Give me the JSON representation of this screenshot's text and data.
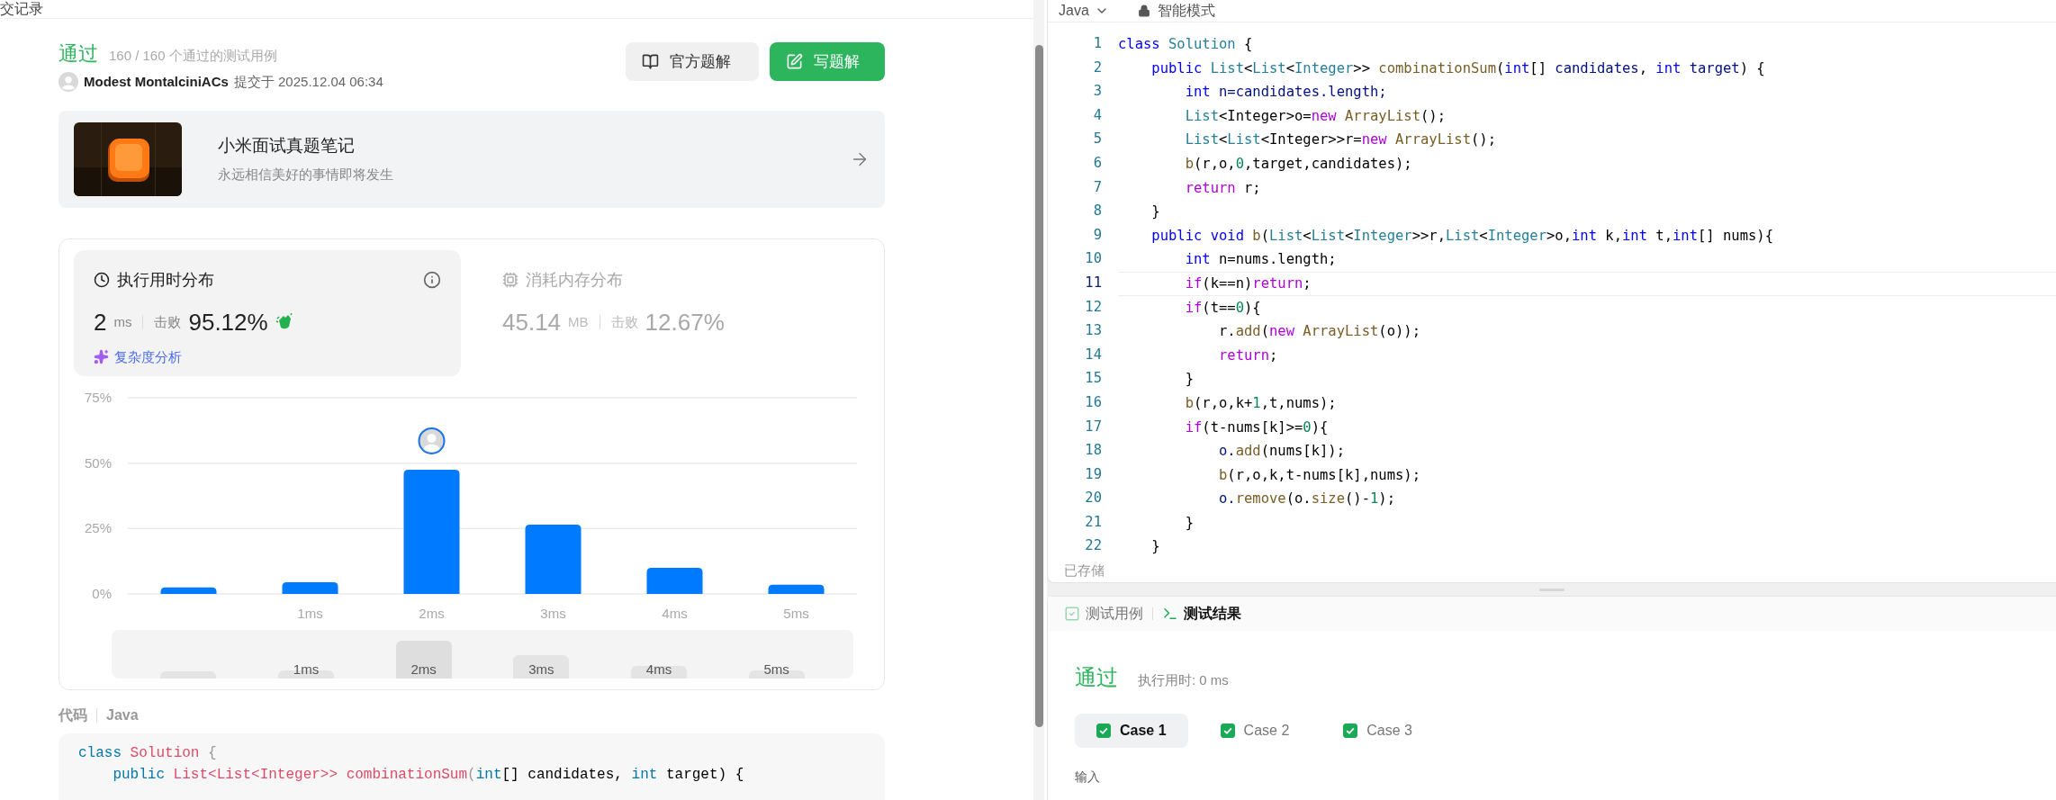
{
  "left_panel": {
    "header_title": "交记录"
  },
  "submission": {
    "status": "通过",
    "passed_cases": "160 / 160 个通过的测试用例",
    "author": "Modest MontalciniACs",
    "submitted_at": "提交于 2025.12.04 06:34",
    "buttons": [
      {
        "label": "官方题解",
        "kind": "secondary"
      },
      {
        "label": "写题解",
        "kind": "primary"
      }
    ]
  },
  "banner": {
    "title": "小米面试真题笔记",
    "subtitle": "永远相信美好的事情即将发生"
  },
  "metrics": [
    {
      "kind": "runtime",
      "title": "执行用时分布",
      "value": "2",
      "unit": "ms",
      "beat_label": "击败",
      "beat": "95.12%",
      "selected": true,
      "analysis_link": "复杂度分析"
    },
    {
      "kind": "memory",
      "title": "消耗内存分布",
      "value": "45.14",
      "unit": "MB",
      "beat_label": "击败",
      "beat": "12.67%",
      "selected": false
    }
  ],
  "runtime_chart": {
    "chart_data": {
      "type": "bar",
      "categories": [
        null,
        "1ms",
        "2ms",
        "3ms",
        "4ms",
        "5ms"
      ],
      "values": [
        2.5,
        4.5,
        47.5,
        26.5,
        10,
        3.5
      ],
      "ylim": [
        0,
        75
      ],
      "yticks": [
        {
          "value": 0,
          "label": "0%"
        },
        {
          "value": 25,
          "label": "25%"
        },
        {
          "value": 50,
          "label": "50%"
        },
        {
          "value": 75,
          "label": "75%"
        }
      ]
    },
    "bars": [
      {
        "selected": false
      },
      {
        "selected": false
      },
      {
        "selected": true
      },
      {
        "selected": false
      },
      {
        "selected": false
      },
      {
        "selected": false
      }
    ],
    "overview_labels": [
      "1ms",
      "2ms",
      "3ms",
      "4ms",
      "5ms"
    ]
  },
  "code_section": {
    "title": "代码",
    "language": "Java",
    "lines": [
      [
        {
          "text": "class",
          "kind": "k"
        },
        {
          "text": " Solution",
          "kind": "t"
        },
        {
          "text": " {",
          "kind": "g"
        }
      ],
      [
        {
          "text": "    public",
          "kind": "k"
        },
        {
          "text": " List<List<Integer>>",
          "kind": "t"
        },
        {
          "text": " combinationSum",
          "kind": "t"
        },
        {
          "text": "(",
          "kind": "g"
        },
        {
          "text": "int",
          "kind": "k"
        },
        {
          "text": "[] candidates,",
          "kind": "p"
        },
        {
          "text": " int",
          "kind": "k"
        },
        {
          "text": " target) {",
          "kind": "p"
        }
      ]
    ]
  },
  "editor": {
    "language": "Java",
    "mode": "智能模式",
    "save_status": "已存储",
    "lines": [
      {
        "number": "1",
        "current": false,
        "tokens": [
          {
            "text": "class",
            "kind": "k"
          },
          {
            "text": " Solution",
            "kind": "t"
          },
          {
            "text": " {",
            "kind": "p"
          }
        ]
      },
      {
        "number": "2",
        "current": false,
        "tokens": [
          {
            "text": "    public",
            "kind": "k"
          },
          {
            "text": " List",
            "kind": "t"
          },
          {
            "text": "<",
            "kind": "p"
          },
          {
            "text": "List",
            "kind": "t"
          },
          {
            "text": "<",
            "kind": "p"
          },
          {
            "text": "Integer",
            "kind": "t"
          },
          {
            "text": ">> ",
            "kind": "p"
          },
          {
            "text": "combinationSum",
            "kind": "f"
          },
          {
            "text": "(",
            "kind": "p"
          },
          {
            "text": "int",
            "kind": "k"
          },
          {
            "text": "[] ",
            "kind": "p"
          },
          {
            "text": "candidates",
            "kind": "v"
          },
          {
            "text": ", ",
            "kind": "p"
          },
          {
            "text": "int",
            "kind": "k"
          },
          {
            "text": " target",
            "kind": "v"
          },
          {
            "text": ") {",
            "kind": "p"
          }
        ]
      },
      {
        "number": "3",
        "current": false,
        "tokens": [
          {
            "text": "        int",
            "kind": "k"
          },
          {
            "text": " n=candidates.length;",
            "kind": "v"
          }
        ]
      },
      {
        "number": "4",
        "current": false,
        "tokens": [
          {
            "text": "        List",
            "kind": "t"
          },
          {
            "text": "<Integer>o=",
            "kind": "p"
          },
          {
            "text": "new",
            "kind": "c"
          },
          {
            "text": " ArrayList",
            "kind": "f"
          },
          {
            "text": "();",
            "kind": "p"
          }
        ]
      },
      {
        "number": "5",
        "current": false,
        "tokens": [
          {
            "text": "        List",
            "kind": "t"
          },
          {
            "text": "<",
            "kind": "p"
          },
          {
            "text": "List",
            "kind": "t"
          },
          {
            "text": "<Integer>>r=",
            "kind": "p"
          },
          {
            "text": "new",
            "kind": "c"
          },
          {
            "text": " ArrayList",
            "kind": "f"
          },
          {
            "text": "();",
            "kind": "p"
          }
        ]
      },
      {
        "number": "6",
        "current": false,
        "tokens": [
          {
            "text": "        b",
            "kind": "f"
          },
          {
            "text": "(r,o,",
            "kind": "p"
          },
          {
            "text": "0",
            "kind": "n"
          },
          {
            "text": ",target,candidates);",
            "kind": "p"
          }
        ]
      },
      {
        "number": "7",
        "current": false,
        "tokens": [
          {
            "text": "        return",
            "kind": "c"
          },
          {
            "text": " r;",
            "kind": "p"
          }
        ]
      },
      {
        "number": "8",
        "current": false,
        "tokens": [
          {
            "text": "    }",
            "kind": "p"
          }
        ]
      },
      {
        "number": "9",
        "current": false,
        "tokens": [
          {
            "text": "    public",
            "kind": "k"
          },
          {
            "text": " void",
            "kind": "k"
          },
          {
            "text": " b",
            "kind": "f"
          },
          {
            "text": "(",
            "kind": "p"
          },
          {
            "text": "List",
            "kind": "t"
          },
          {
            "text": "<",
            "kind": "p"
          },
          {
            "text": "List",
            "kind": "t"
          },
          {
            "text": "<",
            "kind": "p"
          },
          {
            "text": "Integer",
            "kind": "t"
          },
          {
            "text": ">>r,",
            "kind": "p"
          },
          {
            "text": "List",
            "kind": "t"
          },
          {
            "text": "<",
            "kind": "p"
          },
          {
            "text": "Integer",
            "kind": "t"
          },
          {
            "text": ">o,",
            "kind": "p"
          },
          {
            "text": "int",
            "kind": "k"
          },
          {
            "text": " k,",
            "kind": "p"
          },
          {
            "text": "int",
            "kind": "k"
          },
          {
            "text": " t,",
            "kind": "p"
          },
          {
            "text": "int",
            "kind": "k"
          },
          {
            "text": "[] nums){",
            "kind": "p"
          }
        ]
      },
      {
        "number": "10",
        "current": false,
        "tokens": [
          {
            "text": "        int",
            "kind": "k"
          },
          {
            "text": " n=nums.length;",
            "kind": "p"
          }
        ]
      },
      {
        "number": "11",
        "current": true,
        "tokens": [
          {
            "text": "        if",
            "kind": "c"
          },
          {
            "text": "(k==n)",
            "kind": "p"
          },
          {
            "text": "return",
            "kind": "c"
          },
          {
            "text": ";",
            "kind": "p"
          }
        ]
      },
      {
        "number": "12",
        "current": false,
        "tokens": [
          {
            "text": "        if",
            "kind": "c"
          },
          {
            "text": "(t==",
            "kind": "p"
          },
          {
            "text": "0",
            "kind": "n"
          },
          {
            "text": "){",
            "kind": "p"
          }
        ]
      },
      {
        "number": "13",
        "current": false,
        "tokens": [
          {
            "text": "            r.",
            "kind": "p"
          },
          {
            "text": "add",
            "kind": "f"
          },
          {
            "text": "(",
            "kind": "p"
          },
          {
            "text": "new",
            "kind": "c"
          },
          {
            "text": " ArrayList",
            "kind": "f"
          },
          {
            "text": "(o));",
            "kind": "p"
          }
        ]
      },
      {
        "number": "14",
        "current": false,
        "tokens": [
          {
            "text": "            return",
            "kind": "c"
          },
          {
            "text": ";",
            "kind": "p"
          }
        ]
      },
      {
        "number": "15",
        "current": false,
        "tokens": [
          {
            "text": "        }",
            "kind": "p"
          }
        ]
      },
      {
        "number": "16",
        "current": false,
        "tokens": [
          {
            "text": "        b",
            "kind": "f"
          },
          {
            "text": "(r,o,k+",
            "kind": "p"
          },
          {
            "text": "1",
            "kind": "n"
          },
          {
            "text": ",t,nums);",
            "kind": "p"
          }
        ]
      },
      {
        "number": "17",
        "current": false,
        "tokens": [
          {
            "text": "        if",
            "kind": "c"
          },
          {
            "text": "(t-nums[k]>=",
            "kind": "p"
          },
          {
            "text": "0",
            "kind": "n"
          },
          {
            "text": "){",
            "kind": "p"
          }
        ]
      },
      {
        "number": "18",
        "current": false,
        "tokens": [
          {
            "text": "            o.",
            "kind": "v"
          },
          {
            "text": "add",
            "kind": "f"
          },
          {
            "text": "(nums[k]);",
            "kind": "p"
          }
        ]
      },
      {
        "number": "19",
        "current": false,
        "tokens": [
          {
            "text": "            b",
            "kind": "f"
          },
          {
            "text": "(r,o,k,t-nums[k],nums);",
            "kind": "p"
          }
        ]
      },
      {
        "number": "20",
        "current": false,
        "tokens": [
          {
            "text": "            o.",
            "kind": "v"
          },
          {
            "text": "remove",
            "kind": "f"
          },
          {
            "text": "(o.",
            "kind": "p"
          },
          {
            "text": "size",
            "kind": "f"
          },
          {
            "text": "()-",
            "kind": "p"
          },
          {
            "text": "1",
            "kind": "n"
          },
          {
            "text": ");",
            "kind": "p"
          }
        ]
      },
      {
        "number": "21",
        "current": false,
        "tokens": [
          {
            "text": "        }",
            "kind": "p"
          }
        ]
      },
      {
        "number": "22",
        "current": false,
        "tokens": [
          {
            "text": "    }",
            "kind": "p"
          }
        ]
      }
    ]
  },
  "test_panel": {
    "tabs": [
      {
        "kind": "cases",
        "label": "测试用例",
        "selected": false
      },
      {
        "kind": "result",
        "label": "测试结果",
        "selected": true
      }
    ],
    "status": "通过",
    "runtime": "执行用时: 0 ms",
    "cases": [
      {
        "label": "Case 1",
        "selected": true,
        "passed": true
      },
      {
        "label": "Case 2",
        "selected": false,
        "passed": true
      },
      {
        "label": "Case 3",
        "selected": false,
        "passed": true
      }
    ],
    "input_label": "输入"
  }
}
